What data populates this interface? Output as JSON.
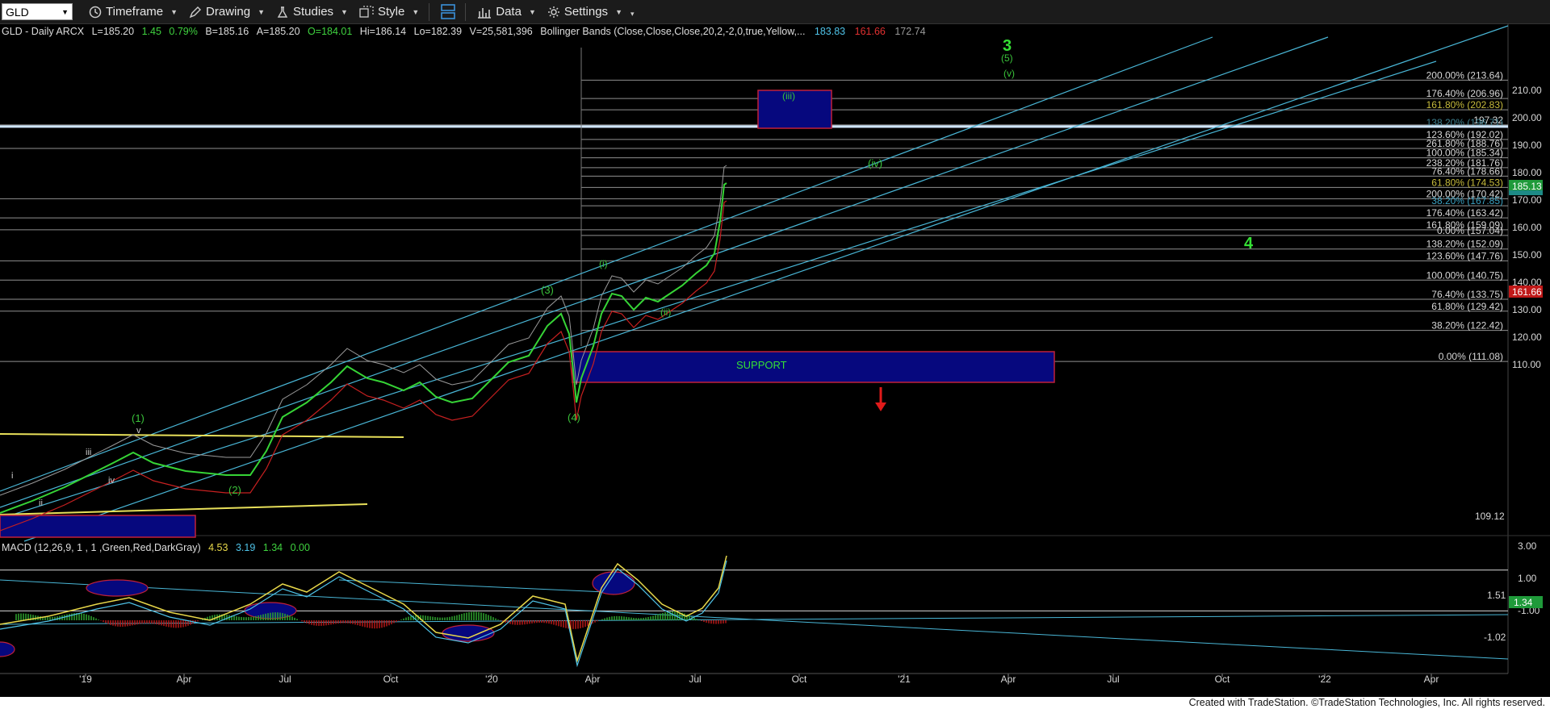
{
  "toolbar": {
    "symbol": "GLD",
    "timeframe": "Timeframe",
    "drawing": "Drawing",
    "studies": "Studies",
    "style": "Style",
    "data": "Data",
    "settings": "Settings"
  },
  "info": {
    "name": "GLD - Daily  ARCX",
    "last": "L=185.20",
    "change": "1.45",
    "change_pct": "0.79%",
    "bid": "B=185.16",
    "ask": "A=185.20",
    "open": "O=184.01",
    "high": "Hi=186.14",
    "low": "Lo=182.39",
    "volume": "V=25,581,396",
    "study": "Bollinger Bands (Close,Close,Close,20,2,-2,0,true,Yellow,...",
    "bb_upper": "183.83",
    "bb_lower": "161.66",
    "bb_mid": "172.74"
  },
  "macd": {
    "label": "MACD (12,26,9, 1 , 1 ,Green,Red,DarkGray)",
    "v1": "4.53",
    "v2": "3.19",
    "v3": "1.34",
    "v4": "0.00",
    "axis": [
      "3.00",
      "1.00",
      "-1.00"
    ],
    "mark_hi": "1.51",
    "mark_lo": "-1.02",
    "current": "1.34"
  },
  "price_axis": [
    "210.00",
    "200.00",
    "190.00",
    "180.00",
    "170.00",
    "160.00",
    "150.00",
    "140.00",
    "130.00",
    "120.00",
    "110.00"
  ],
  "current_price": "185.13",
  "lower_flag": "161.66",
  "left_level_110": "109.12",
  "fib_levels": [
    {
      "label": "200.00% (213.64)",
      "price": 213.64,
      "color": "#d8d8d8"
    },
    {
      "label": "176.40% (206.96)",
      "price": 206.96,
      "color": "#d8d8d8"
    },
    {
      "label": "161.80% (202.83)",
      "price": 202.83,
      "color": "#c6bb3c"
    },
    {
      "label": "197.32",
      "price": 197.32,
      "color": "#d8d8d8"
    },
    {
      "label": "138.20% (196.71)",
      "price": 196.4,
      "color": "#3d7f8f"
    },
    {
      "label": "123.60% (192.02)",
      "price": 192.02,
      "color": "#d8d8d8"
    },
    {
      "label": "261.80% (188.76)",
      "price": 188.76,
      "color": "#d8d8d8"
    },
    {
      "label": "100.00% (185.34)",
      "price": 185.34,
      "color": "#d8d8d8"
    },
    {
      "label": "238.20% (181.76)",
      "price": 181.76,
      "color": "#d8d8d8"
    },
    {
      "label": "76.40% (178.66)",
      "price": 178.66,
      "color": "#d8d8d8"
    },
    {
      "label": "61.80% (174.53)",
      "price": 174.53,
      "color": "#c6bb3c"
    },
    {
      "label": "200.00% (170.42)",
      "price": 170.42,
      "color": "#d8d8d8"
    },
    {
      "label": "38.20% (167.85)",
      "price": 167.85,
      "color": "#3aa0c0"
    },
    {
      "label": "176.40% (163.42)",
      "price": 163.42,
      "color": "#d8d8d8"
    },
    {
      "label": "161.80% (159.09)",
      "price": 159.09,
      "color": "#d8d8d8"
    },
    {
      "label": "0.00% (157.04)",
      "price": 157.04,
      "color": "#d8d8d8"
    },
    {
      "label": "138.20% (152.09)",
      "price": 152.09,
      "color": "#d8d8d8"
    },
    {
      "label": "123.60% (147.76)",
      "price": 147.76,
      "color": "#d8d8d8"
    },
    {
      "label": "100.00% (140.75)",
      "price": 140.75,
      "color": "#d8d8d8"
    },
    {
      "label": "76.40% (133.75)",
      "price": 133.75,
      "color": "#d8d8d8"
    },
    {
      "label": "61.80% (129.42)",
      "price": 129.42,
      "color": "#d8d8d8"
    },
    {
      "label": "38.20% (122.42)",
      "price": 122.42,
      "color": "#d8d8d8"
    },
    {
      "label": "0.00% (111.08)",
      "price": 111.08,
      "color": "#d8d8d8"
    }
  ],
  "date_axis": [
    "'19",
    "Apr",
    "Jul",
    "Oct",
    "'20",
    "Apr",
    "Jul",
    "Oct",
    "'21",
    "Apr",
    "Jul",
    "Oct",
    "'22",
    "Apr"
  ],
  "wave_labels": {
    "w3": "3",
    "w5": "(5)",
    "wv": "(v)",
    "wiii": "(iii)",
    "wiv": "(iv)",
    "w4": "4",
    "wi": "(i)",
    "wii": "(ii)",
    "w3p": "(3)",
    "w4p": "(4)",
    "w1p": "(1)",
    "wv_small": "v",
    "wiii_small": "iii",
    "wiv_small": "iv",
    "wi_small": "i",
    "wii_small": "ii",
    "w2p": "(2)"
  },
  "support_label": "SUPPORT",
  "footer": "Created with TradeStation. ©TradeStation Technologies, Inc. All rights reserved."
}
